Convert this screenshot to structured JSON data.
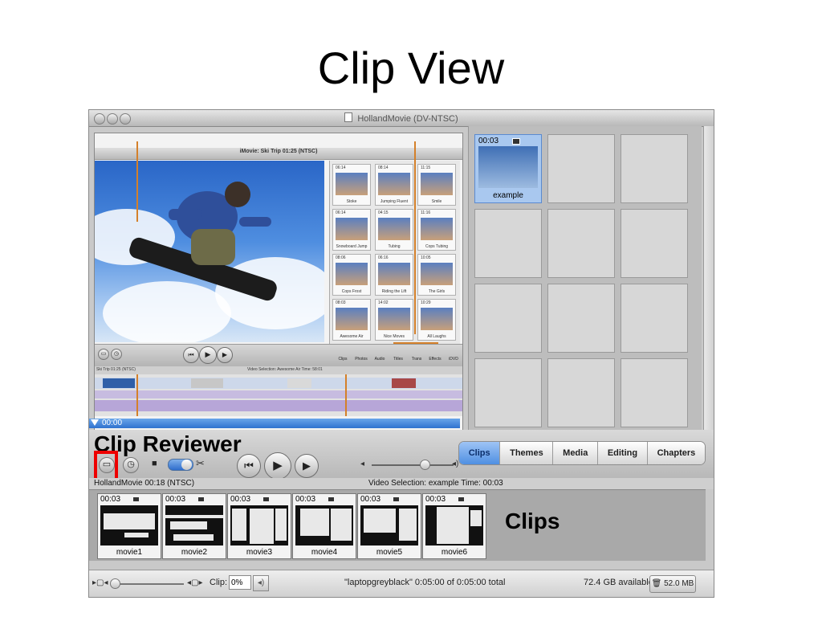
{
  "slide": {
    "title": "Clip View"
  },
  "window": {
    "title": "HollandMovie (DV-NTSC)"
  },
  "monitor": {
    "inner_title": "iMovie: Ski Trip  01:25 (NTSC)",
    "inner_status_left": "Ski Trip  01:25 (NTSC)",
    "inner_status_right": "Video Selection: Awesome Air  Time: 58:01",
    "inner_clips": [
      {
        "time": "06:14",
        "caption": "Stoke"
      },
      {
        "time": "08:14",
        "caption": "Jumping Fluent"
      },
      {
        "time": "11:15",
        "caption": "Smile"
      },
      {
        "time": "06:14",
        "caption": "Snowboard Jump"
      },
      {
        "time": "04:15",
        "caption": "Tubing"
      },
      {
        "time": "11:16",
        "caption": "Cops Tubing"
      },
      {
        "time": "08:06",
        "caption": "Cops Frost"
      },
      {
        "time": "06:16",
        "caption": "Riding the Lift"
      },
      {
        "time": "10:05",
        "caption": "The Girls"
      },
      {
        "time": "08:03",
        "caption": "Awesome Air"
      },
      {
        "time": "14:02",
        "caption": "Nice Moves"
      },
      {
        "time": "10:29",
        "caption": "All Laughs"
      }
    ],
    "inner_tabs": [
      "Clips",
      "Photos",
      "Audio",
      "Titles",
      "Trans",
      "Effects",
      "iDVD"
    ]
  },
  "timecode": "00:00",
  "labels": {
    "clip_reviewer": "Clip Reviewer",
    "clips": "Clips"
  },
  "shelf": {
    "clips": [
      {
        "time": "00:03",
        "name": "example",
        "selected": true
      }
    ],
    "empty_cells": 11
  },
  "tabs": [
    {
      "label": "Clips",
      "active": true
    },
    {
      "label": "Themes",
      "active": false
    },
    {
      "label": "Media",
      "active": false
    },
    {
      "label": "Editing",
      "active": false
    },
    {
      "label": "Chapters",
      "active": false
    }
  ],
  "status": {
    "left": "HollandMovie  00:18 (NTSC)",
    "right": "Video Selection: example  Time: 00:03"
  },
  "clip_viewer": [
    {
      "time": "00:03",
      "name": "movie1"
    },
    {
      "time": "00:03",
      "name": "movie2"
    },
    {
      "time": "00:03",
      "name": "movie3"
    },
    {
      "time": "00:03",
      "name": "movie4"
    },
    {
      "time": "00:03",
      "name": "movie5"
    },
    {
      "time": "00:03",
      "name": "movie6"
    }
  ],
  "bottom_bar": {
    "clip_label": "Clip:",
    "clip_volume": "0%",
    "project_info": "\"laptopgreyblack\"  0:05:00 of 0:05:00 total",
    "disk_space": "72.4 GB available",
    "trash_size": "52.0 MB"
  },
  "colors": {
    "accent_blue": "#4f8fe2",
    "highlight_red": "#ee0000",
    "annotation_orange": "#d4802a"
  }
}
